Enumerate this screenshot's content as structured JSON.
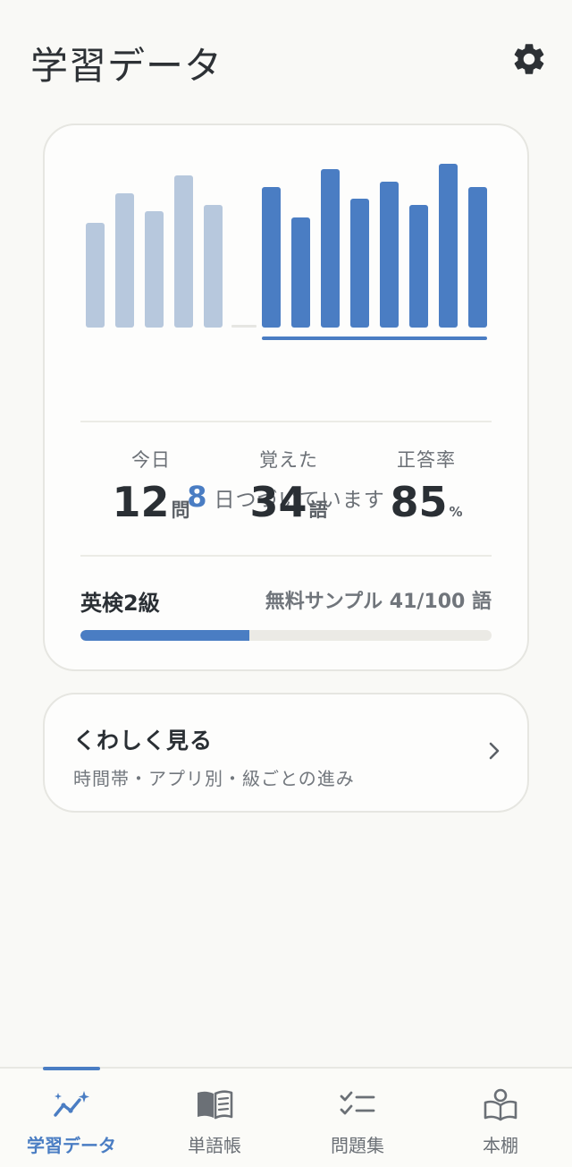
{
  "header": {
    "title": "学習データ"
  },
  "chart_data": {
    "type": "bar",
    "series": [
      {
        "values": [
          117,
          150,
          130,
          170,
          137,
          3
        ]
      },
      {
        "values": [
          157,
          123,
          177,
          144,
          163,
          137,
          183,
          157
        ]
      }
    ],
    "colors": {
      "past": "#b7c8dd",
      "streak": "#4a7dc3",
      "empty": "#e6e6e2"
    }
  },
  "streak": {
    "count": "8",
    "label": "日つづいています"
  },
  "stats": [
    {
      "label": "今日",
      "value": "12",
      "unit": "問"
    },
    {
      "label": "覚えた",
      "value": "34",
      "unit": "語"
    },
    {
      "label": "正答率",
      "value": "85",
      "unit": "%"
    }
  ],
  "level": {
    "name": "英検2級",
    "progress_text": "無料サンプル 41/100 語",
    "progress": 0.41
  },
  "detail": {
    "title": "くわしく見る",
    "subtitle": "時間帯・アプリ別・級ごとの進み"
  },
  "tabs": [
    {
      "label": "学習データ",
      "icon": "chart-sparkle-icon",
      "active": true
    },
    {
      "label": "単語帳",
      "icon": "book-icon",
      "active": false
    },
    {
      "label": "問題集",
      "icon": "checklist-icon",
      "active": false
    },
    {
      "label": "本棚",
      "icon": "bookshelf-icon",
      "active": false
    }
  ],
  "colors": {
    "accent": "#4a7dc3",
    "text": "#2a2f34",
    "muted": "#6b7076"
  }
}
